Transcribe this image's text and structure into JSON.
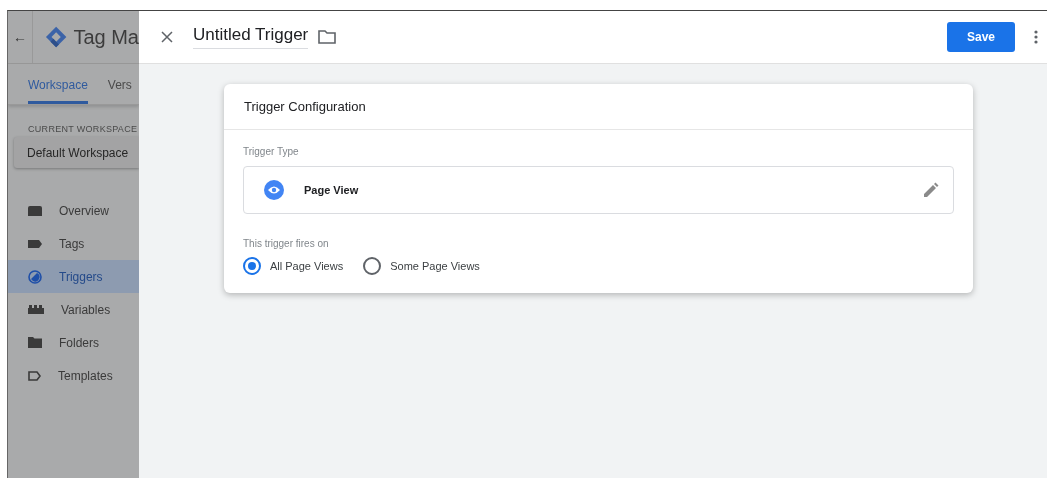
{
  "sidebar": {
    "back": "←",
    "app_title": "Tag Ma",
    "tabs": [
      {
        "label": "Workspace",
        "selected": true
      },
      {
        "label": "Vers",
        "selected": false
      }
    ],
    "workspace_label": "CURRENT WORKSPACE",
    "workspace": "Default Workspace",
    "items": [
      {
        "label": "Overview",
        "kind": "overview",
        "selected": false
      },
      {
        "label": "Tags",
        "kind": "tag",
        "selected": false
      },
      {
        "label": "Triggers",
        "kind": "trigger",
        "selected": true
      },
      {
        "label": "Variables",
        "kind": "variable",
        "selected": false
      },
      {
        "label": "Folders",
        "kind": "folder",
        "selected": false
      },
      {
        "label": "Templates",
        "kind": "template",
        "selected": false
      }
    ]
  },
  "header": {
    "title": "Untitled Trigger",
    "save": "Save"
  },
  "card": {
    "title": "Trigger Configuration",
    "type_label": "Trigger Type",
    "type": "Page View",
    "fires_label": "This trigger fires on",
    "options": [
      {
        "label": "All Page Views",
        "selected": true
      },
      {
        "label": "Some Page Views",
        "selected": false
      }
    ]
  }
}
